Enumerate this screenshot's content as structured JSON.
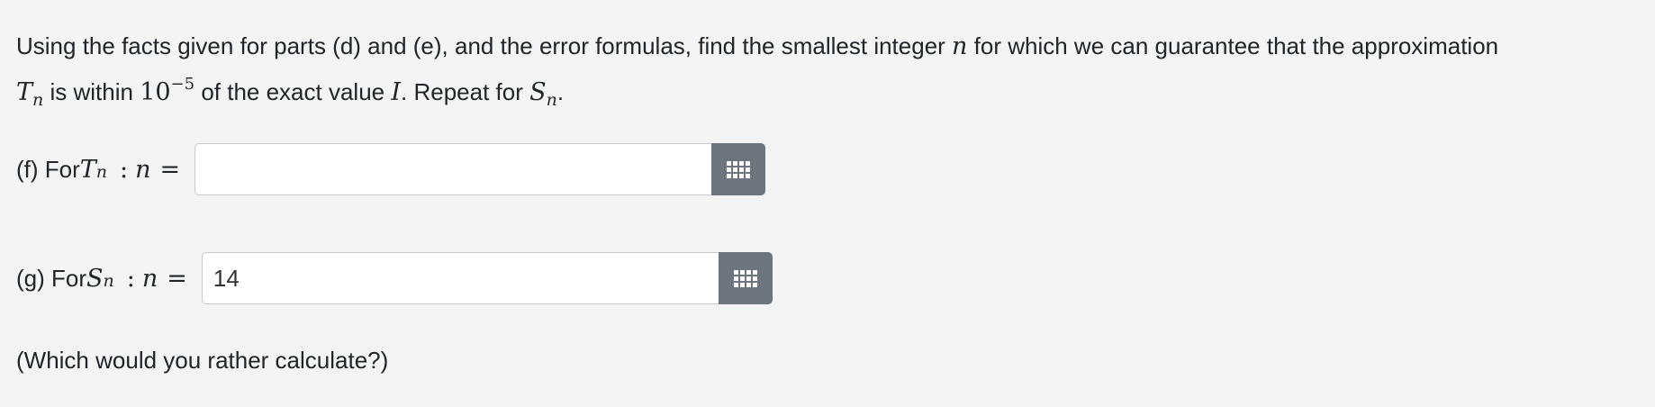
{
  "prompt": {
    "line1_text": "Using the facts given for parts (d) and (e), and the error formulas, find the smallest integer ",
    "line1_var": "n",
    "line1_end": " for which we can guarantee that the approximation",
    "line2_T": "T",
    "line2_T_sub": "n",
    "line2_mid": " is within ",
    "line2_base": "10",
    "line2_exp": "−5",
    "line2_mid2": " of the exact value ",
    "line2_I": "I",
    "line2_mid3": ". Repeat for ",
    "line2_S": "S",
    "line2_S_sub": "n",
    "line2_end": "."
  },
  "part_f": {
    "label_prefix": "(f) For ",
    "var": "T",
    "var_sub": "n",
    "colon": ":",
    "n": "n",
    "equals": "=",
    "input_value": "",
    "grid_icon": "grid-icon"
  },
  "part_g": {
    "label_prefix": "(g) For ",
    "var": "S",
    "var_sub": "n",
    "colon": ":",
    "n": "n",
    "equals": "=",
    "input_value": "14",
    "grid_icon": "grid-icon"
  },
  "footer": {
    "note": "(Which would you rather calculate?)"
  }
}
